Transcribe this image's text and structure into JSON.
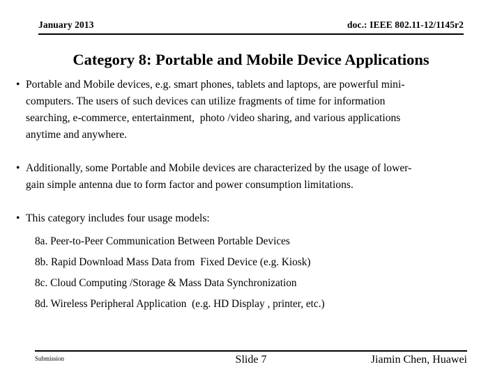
{
  "header": {
    "date": "January 2013",
    "doc": "doc.: IEEE 802.11-12/1145r2"
  },
  "title": "Category 8: Portable and Mobile Device Applications",
  "bullets": [
    {
      "marker": "•",
      "lines": [
        "Portable and Mobile devices, e.g. smart phones, tablets and laptops, are powerful mini-",
        "computers. The users of such devices can utilize fragments of time for information",
        "searching, e-commerce, entertainment,  photo /video sharing, and various applications",
        "anytime and anywhere."
      ]
    },
    {
      "marker": "•",
      "lines": [
        "Additionally, some Portable and Mobile devices are characterized by the usage of lower-",
        "gain simple antenna due to form factor and power consumption limitations."
      ]
    },
    {
      "marker": "•",
      "lines": [
        "This category includes four usage models:"
      ]
    }
  ],
  "subitems": [
    "8a. Peer-to-Peer Communication Between Portable Devices",
    "8b. Rapid Download Mass Data from  Fixed Device (e.g. Kiosk)",
    "8c. Cloud Computing /Storage & Mass Data Synchronization",
    "8d. Wireless Peripheral Application  (e.g. HD Display , printer, etc.)"
  ],
  "footer": {
    "left": "Submission",
    "center": "Slide 7",
    "right": "Jiamin Chen, Huawei"
  },
  "colors": {
    "text": "#000000",
    "background": "#ffffff",
    "rule": "#000000"
  }
}
